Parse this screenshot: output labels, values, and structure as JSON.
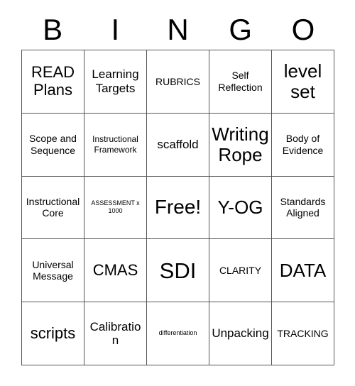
{
  "card": {
    "title": "BINGO",
    "header_letters": [
      "B",
      "I",
      "N",
      "G",
      "O"
    ],
    "grid_columns": 5,
    "grid_rows": 5,
    "colors": {
      "background": "#ffffff",
      "text": "#000000",
      "grid_line": "#555555"
    },
    "cells": [
      {
        "id": "b1",
        "column": "B",
        "row": 1,
        "text": "READ Plans",
        "size": "xl",
        "free": false
      },
      {
        "id": "i1",
        "column": "I",
        "row": 1,
        "text": "Learning Targets",
        "size": "lg",
        "free": false
      },
      {
        "id": "n1",
        "column": "N",
        "row": 1,
        "text": "RUBRICS",
        "size": "md",
        "free": false
      },
      {
        "id": "g1",
        "column": "G",
        "row": 1,
        "text": "Self Reflection",
        "size": "md",
        "free": false
      },
      {
        "id": "o1",
        "column": "O",
        "row": 1,
        "text": "level set",
        "size": "xxl",
        "free": false
      },
      {
        "id": "b2",
        "column": "B",
        "row": 2,
        "text": "Scope and Sequence",
        "size": "md",
        "free": false
      },
      {
        "id": "i2",
        "column": "I",
        "row": 2,
        "text": "Instructional Framework",
        "size": "sm",
        "free": false
      },
      {
        "id": "n2",
        "column": "N",
        "row": 2,
        "text": "scaffold",
        "size": "lg",
        "free": false
      },
      {
        "id": "g2",
        "column": "G",
        "row": 2,
        "text": "Writing Rope",
        "size": "xxl",
        "free": false
      },
      {
        "id": "o2",
        "column": "O",
        "row": 2,
        "text": "Body of Evidence",
        "size": "md",
        "free": false
      },
      {
        "id": "b3",
        "column": "B",
        "row": 3,
        "text": "Instructional Core",
        "size": "md",
        "free": false
      },
      {
        "id": "i3",
        "column": "I",
        "row": 3,
        "text": "ASSESSMENT x 1000",
        "size": "xs",
        "free": false
      },
      {
        "id": "n3",
        "column": "N",
        "row": 3,
        "text": "Free!",
        "size": "huge",
        "free": true
      },
      {
        "id": "g3",
        "column": "G",
        "row": 3,
        "text": "Y-OG",
        "size": "xxl",
        "free": false
      },
      {
        "id": "o3",
        "column": "O",
        "row": 3,
        "text": "Standards Aligned",
        "size": "md",
        "free": false
      },
      {
        "id": "b4",
        "column": "B",
        "row": 4,
        "text": "Universal Message",
        "size": "md",
        "free": false
      },
      {
        "id": "i4",
        "column": "I",
        "row": 4,
        "text": "CMAS",
        "size": "xl",
        "free": false
      },
      {
        "id": "n4",
        "column": "N",
        "row": 4,
        "text": "SDI",
        "size": "huge",
        "free": false
      },
      {
        "id": "g4",
        "column": "G",
        "row": 4,
        "text": "CLARITY",
        "size": "md",
        "free": false
      },
      {
        "id": "o4",
        "column": "O",
        "row": 4,
        "text": "DATA",
        "size": "xxl",
        "free": false
      },
      {
        "id": "b5",
        "column": "B",
        "row": 5,
        "text": "scripts",
        "size": "xl",
        "free": false
      },
      {
        "id": "i5",
        "column": "I",
        "row": 5,
        "text": "Calibration",
        "size": "lg",
        "free": false
      },
      {
        "id": "n5",
        "column": "N",
        "row": 5,
        "text": "differentiation",
        "size": "xs",
        "free": false
      },
      {
        "id": "g5",
        "column": "G",
        "row": 5,
        "text": "Unpacking",
        "size": "lg",
        "free": false
      },
      {
        "id": "o5",
        "column": "O",
        "row": 5,
        "text": "TRACKING",
        "size": "md",
        "free": false
      }
    ]
  }
}
